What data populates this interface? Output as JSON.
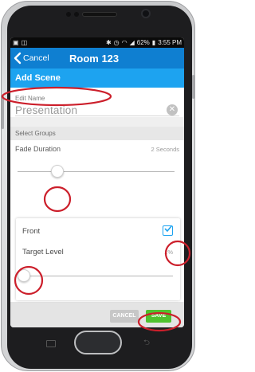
{
  "status_bar": {
    "battery": "62%",
    "time": "3:55 PM"
  },
  "nav": {
    "cancel_label": "Cancel",
    "title": "Room 123"
  },
  "add_scene": {
    "header": "Add Scene"
  },
  "edit_name": {
    "label": "Edit Name",
    "value": "Presentation"
  },
  "select_groups_label": "Select Groups",
  "fade": {
    "label": "Fade Duration",
    "value": "2 Seconds",
    "slider_fraction": 0.29
  },
  "group": {
    "name": "Front",
    "checked": true,
    "target_label": "Target Level",
    "target_value": "1%",
    "slider_fraction": 0.01
  },
  "buttons": {
    "cancel": "CANCEL",
    "save": "SAVE"
  },
  "colors": {
    "nav_bar": "#0f7fd1",
    "section_header": "#1da3f0",
    "save_button": "#4fc12e",
    "cancel_button": "#c7c7c7",
    "annotation": "#cc1f2b"
  },
  "icons": {
    "nav_back": "chevron-left-icon",
    "clear": "clear-x-icon",
    "checkbox": "checkbox-checked-icon"
  }
}
